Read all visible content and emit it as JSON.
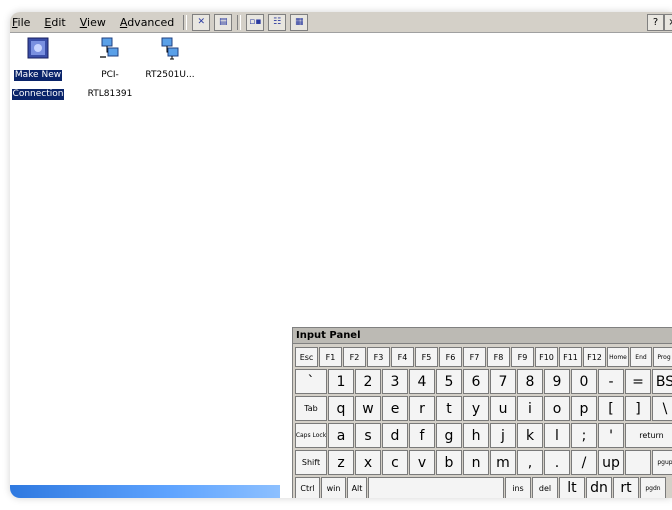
{
  "menu": {
    "items": [
      "File",
      "Edit",
      "View",
      "Advanced"
    ],
    "help_label": "?",
    "close_label": "×"
  },
  "toolbar": {
    "icons": [
      "delete-icon",
      "properties-icon",
      "large-icons-icon",
      "details-icon",
      "list-icon"
    ]
  },
  "icons": [
    {
      "name": "make-new-connection",
      "label_line1": "Make New",
      "label_line2": "Connection",
      "selected": true
    },
    {
      "name": "pci-rtl81391",
      "label_line1": "PCI-",
      "label_line2": "RTL81391",
      "selected": false
    },
    {
      "name": "rt2501u",
      "label_line1": "RT2501U...",
      "label_line2": "",
      "selected": false
    }
  ],
  "input_panel": {
    "title": "Input Panel",
    "row1": [
      "Esc",
      "F1",
      "F2",
      "F3",
      "F4",
      "F5",
      "F6",
      "F7",
      "F8",
      "F9",
      "F10",
      "F11",
      "F12",
      "Home",
      "End",
      "Prog"
    ],
    "row2": [
      "`",
      "1",
      "2",
      "3",
      "4",
      "5",
      "6",
      "7",
      "8",
      "9",
      "0",
      "-",
      "=",
      "BS"
    ],
    "row3": [
      "Tab",
      "q",
      "w",
      "e",
      "r",
      "t",
      "y",
      "u",
      "i",
      "o",
      "p",
      "[",
      "]",
      "\\"
    ],
    "row4": [
      "Caps Lock",
      "a",
      "s",
      "d",
      "f",
      "g",
      "h",
      "j",
      "k",
      "l",
      ";",
      "'",
      "return"
    ],
    "row5": [
      "Shift",
      "z",
      "x",
      "c",
      "v",
      "b",
      "n",
      "m",
      ",",
      ".",
      "/",
      "up",
      "",
      "pgup"
    ],
    "row6": [
      "Ctrl",
      "win",
      "Alt",
      "",
      "ins",
      "del",
      "lt",
      "dn",
      "rt",
      "pgdn"
    ]
  },
  "colors": {
    "window_bg": "#d4d0c8",
    "selection": "#0a246a",
    "taskbar": "#2f79e0"
  }
}
